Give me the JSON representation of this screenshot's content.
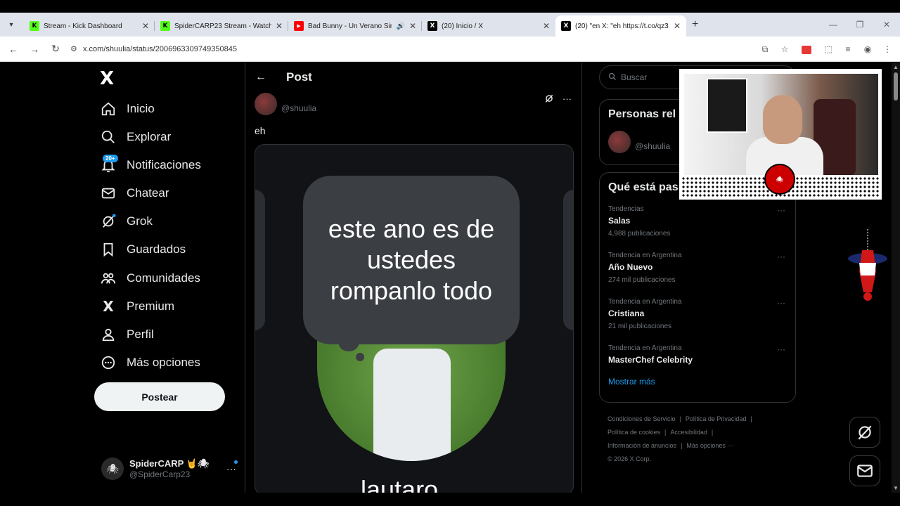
{
  "browser": {
    "tabs": [
      {
        "title": "Stream - Kick Dashboard",
        "favicon": "kick-icon",
        "fav_color": "#53fc18"
      },
      {
        "title": "SpiderCARP23 Stream - Watch",
        "favicon": "kick-icon",
        "fav_color": "#53fc18"
      },
      {
        "title": "Bad Bunny - Un Verano Sin",
        "favicon": "youtube-icon",
        "fav_color": "#ff0000"
      },
      {
        "title": "(20) Inicio / X",
        "favicon": "x-icon",
        "fav_color": "#000000"
      },
      {
        "title": "(20) \"en X: \"eh https://t.co/qz3",
        "favicon": "x-icon",
        "fav_color": "#000000"
      }
    ],
    "url": "x.com/shuulia/status/2006963309749350845"
  },
  "nav": {
    "logo": "X",
    "items": [
      {
        "label": "Inicio",
        "icon": "home-icon"
      },
      {
        "label": "Explorar",
        "icon": "search-icon"
      },
      {
        "label": "Notificaciones",
        "icon": "bell-icon",
        "badge": "20+"
      },
      {
        "label": "Chatear",
        "icon": "mail-icon"
      },
      {
        "label": "Grok",
        "icon": "grok-icon"
      },
      {
        "label": "Guardados",
        "icon": "bookmark-icon"
      },
      {
        "label": "Comunidades",
        "icon": "communities-icon"
      },
      {
        "label": "Premium",
        "icon": "x-icon"
      },
      {
        "label": "Perfil",
        "icon": "person-icon"
      },
      {
        "label": "Más opciones",
        "icon": "more-circle-icon"
      }
    ],
    "post_button": "Postear",
    "account": {
      "name": "SpiderCARP 🤘🕷",
      "handle": "@SpiderCarp23"
    }
  },
  "main": {
    "title": "Post",
    "author_handle": "@shuulia",
    "post_text": "eh",
    "media": {
      "bubble_text": "este ano es de ustedes rompanlo todo",
      "cut_text": "lautaro"
    }
  },
  "right": {
    "search_placeholder": "Buscar",
    "related_title": "Personas rel",
    "related_handle": "@shuulia",
    "trends_title": "Qué está pas",
    "trends": [
      {
        "context": "Tendencias",
        "name": "Salas",
        "count": "4,988 publicaciones"
      },
      {
        "context": "Tendencia en Argentina",
        "name": "Año Nuevo",
        "count": "274 mil publicaciones"
      },
      {
        "context": "Tendencia en Argentina",
        "name": "Cristiana",
        "count": "21 mil publicaciones"
      },
      {
        "context": "Tendencia en Argentina",
        "name": "MasterChef Celebrity",
        "count": ""
      }
    ],
    "show_more": "Mostrar más",
    "footer": {
      "terms": "Condiciones de Servicio",
      "privacy": "Política de Privacidad",
      "cookies": "Política de cookies",
      "accessibility": "Accesibilidad",
      "ads": "Información de anuncios",
      "more": "Más opciones ···",
      "copyright": "© 2026 X Corp."
    }
  },
  "overlay": {
    "cam_logo": "SPIDER CARP"
  },
  "colors": {
    "accent": "#1d9bf0",
    "background": "#000000",
    "border": "#2f3336"
  }
}
